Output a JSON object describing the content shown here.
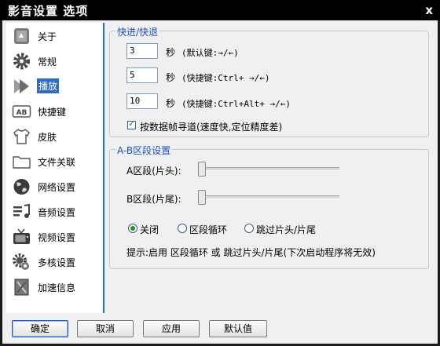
{
  "window": {
    "title": "影音设置 选项",
    "close_glyph": "x"
  },
  "sidebar": {
    "items": [
      {
        "label": "关于",
        "icon": "about-icon"
      },
      {
        "label": "常规",
        "icon": "gear-icon"
      },
      {
        "label": "播放",
        "icon": "play-icon",
        "active": true
      },
      {
        "label": "快捷键",
        "icon": "keyboard-icon"
      },
      {
        "label": "皮肤",
        "icon": "tshirt-icon"
      },
      {
        "label": "文件关联",
        "icon": "folder-icon"
      },
      {
        "label": "网络设置",
        "icon": "globe-icon"
      },
      {
        "label": "音频设置",
        "icon": "audio-icon"
      },
      {
        "label": "视频设置",
        "icon": "tv-icon"
      },
      {
        "label": "多核设置",
        "icon": "cpu-gear-icon"
      },
      {
        "label": "加速信息",
        "icon": "accelerate-icon"
      }
    ]
  },
  "seek": {
    "title": "快进/快退",
    "rows": [
      {
        "value": "3",
        "unit": "秒",
        "hint": "(默认键:→/←)"
      },
      {
        "value": "5",
        "unit": "秒",
        "hint": "(快捷键:Ctrl+ →/←)"
      },
      {
        "value": "10",
        "unit": "秒",
        "hint": "(快捷键:Ctrl+Alt+ →/←)"
      }
    ],
    "keyframe_checkbox": {
      "label": "按数据帧寻道(速度快,定位精度差)",
      "checked": true
    }
  },
  "ab": {
    "title": "A-B区段设置",
    "a_label": "A区段(片头):",
    "b_label": "B区段(片尾):",
    "a_value": 0,
    "b_value": 0,
    "radios": [
      {
        "label": "关闭",
        "selected": true
      },
      {
        "label": "区段循环",
        "selected": false
      },
      {
        "label": "跳过片头/片尾",
        "selected": false
      }
    ],
    "note": "提示:启用 区段循环 或 跳过片头/片尾(下次启动程序将无效)"
  },
  "buttons": {
    "ok": "确定",
    "cancel": "取消",
    "apply": "应用",
    "default": "默认值"
  },
  "colors": {
    "accent": "#1b6fd6",
    "group_title": "#1c4ec7",
    "selection": "#316ac5",
    "check": "#1b7a1b"
  }
}
